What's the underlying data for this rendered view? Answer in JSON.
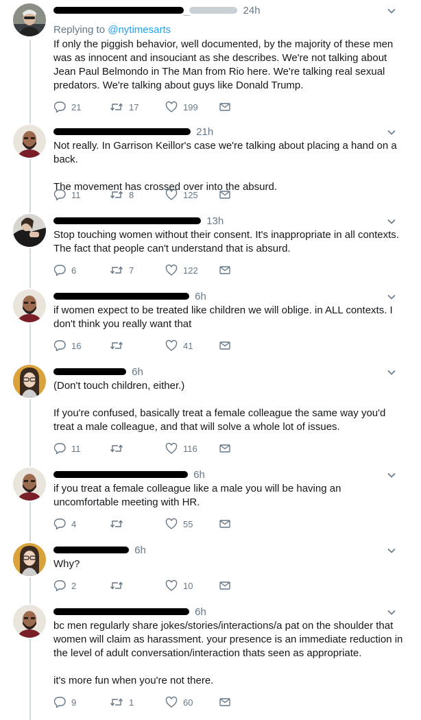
{
  "tweets": [
    {
      "time": "24h",
      "replying_to_label": "Replying to",
      "replying_to_handle": "@nytimesarts",
      "text": [
        "If only the piggish behavior, well documented, by the majority of these men was as innocent and insouciant as she describes. We're not talking about Jean Paul Belmondo in The Man from Rio here. We're talking real sexual predators. We're talking about guys like Donald Trump."
      ],
      "replies": "21",
      "retweets": "17",
      "likes": "199"
    },
    {
      "time": "21h",
      "text": [
        "Not really. In Garrison Keillor's case we're talking about placing a hand on a back.",
        "The movement has crossed over into the absurd."
      ],
      "replies": "11",
      "retweets": "8",
      "likes": "125"
    },
    {
      "time": "13h",
      "text": [
        "Stop touching women without their consent. It's inappropriate in all contexts. The fact that people can't understand that is absurd."
      ],
      "replies": "6",
      "retweets": "7",
      "likes": "122"
    },
    {
      "time": "6h",
      "text": [
        "if women expect to be treated like children we will oblige.  in ALL contexts. I don't think you really want that"
      ],
      "replies": "16",
      "retweets": "",
      "likes": "41"
    },
    {
      "time": "6h",
      "text": [
        "(Don't touch children, either.)",
        "If you're confused, basically treat a female colleague the same way you'd treat a male colleague, and that will solve a whole lot of issues."
      ],
      "replies": "11",
      "retweets": "",
      "likes": "116"
    },
    {
      "time": "6h",
      "text": [
        "if you treat a female colleague like a male you will be having an uncomfortable meeting with HR."
      ],
      "replies": "4",
      "retweets": "",
      "likes": "55"
    },
    {
      "time": "6h",
      "text": [
        "Why?"
      ],
      "replies": "2",
      "retweets": "",
      "likes": "10"
    },
    {
      "time": "6h",
      "text": [
        "bc men regularly share jokes/stories/interactions/a pat on the shoulder that women will claim as harassment.  your presence is an immediate reduction in the level of adult conversation/interaction thats seen as appropriate.",
        "it's more fun when you're not there."
      ],
      "replies": "9",
      "retweets": "1",
      "likes": "60"
    }
  ],
  "colors": {
    "text": "#14171a",
    "muted": "#657786",
    "link": "#1da1f2",
    "thread_line": "#cfd9de",
    "redaction": "#000000"
  },
  "icons": [
    "reply-icon",
    "retweet-icon",
    "like-icon",
    "message-icon",
    "chevron-down-icon"
  ]
}
